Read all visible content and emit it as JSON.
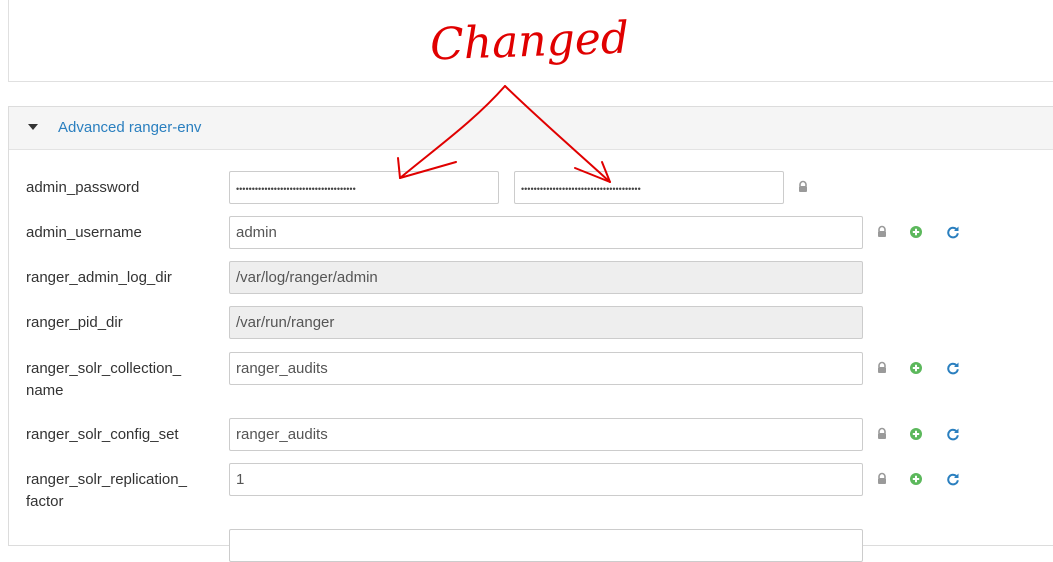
{
  "annotation": {
    "text": "Changed"
  },
  "section": {
    "title": "Advanced ranger-env"
  },
  "fields": {
    "admin_password": {
      "label": "admin_password",
      "value": "••••••••••••••••••••••••••••••••••••••",
      "confirm": "••••••••••••••••••••••••••••••••••••••"
    },
    "admin_username": {
      "label": "admin_username",
      "value": "admin"
    },
    "ranger_admin_log_dir": {
      "label": "ranger_admin_log_dir",
      "value": "/var/log/ranger/admin"
    },
    "ranger_pid_dir": {
      "label": "ranger_pid_dir",
      "value": "/var/run/ranger"
    },
    "ranger_solr_collection_name": {
      "label_line1": "ranger_solr_collection_",
      "label_line2": "name",
      "value": "ranger_audits"
    },
    "ranger_solr_config_set": {
      "label": "ranger_solr_config_set",
      "value": "ranger_audits"
    },
    "ranger_solr_replication_factor": {
      "label_line1": "ranger_solr_replication_",
      "label_line2": "factor",
      "value": "1"
    }
  },
  "icons": {
    "lock": "lock-icon",
    "add": "plus-circle-icon",
    "refresh": "refresh-icon",
    "colors": {
      "lock": "#9a9a9a",
      "add": "#5cb85c",
      "refresh": "#2a7fbf",
      "annotation": "#e00000"
    }
  }
}
